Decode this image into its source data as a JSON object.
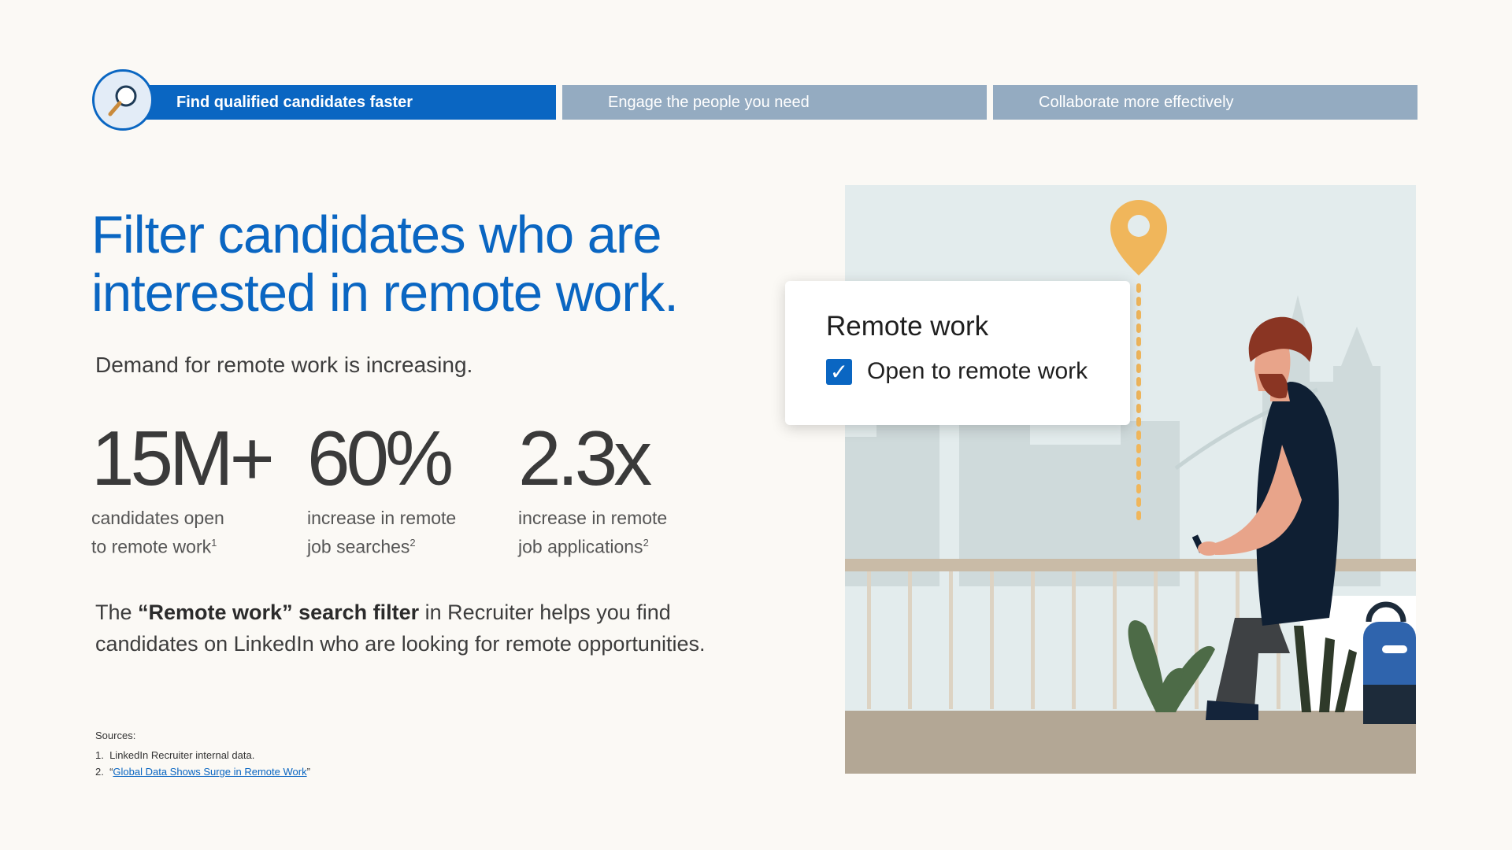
{
  "nav": {
    "icon": "magnifier-icon",
    "tabs": [
      {
        "label": "Find qualified candidates faster",
        "active": true
      },
      {
        "label": "Engage the people you need",
        "active": false
      },
      {
        "label": "Collaborate more effectively",
        "active": false
      }
    ]
  },
  "headline": {
    "line1": "Filter candidates who are",
    "line2": "interested in remote work."
  },
  "subhead": "Demand for remote work is increasing.",
  "stats": [
    {
      "value": "15M+",
      "desc_line1": "candidates open",
      "desc_line2": "to remote work",
      "footnote": "1"
    },
    {
      "value": "60%",
      "desc_line1": "increase in remote",
      "desc_line2": "job searches",
      "footnote": "2"
    },
    {
      "value": "2.3x",
      "desc_line1": "increase in remote",
      "desc_line2": "job applications",
      "footnote": "2"
    }
  ],
  "body": {
    "prefix": "The ",
    "bold": "“Remote work” search filter",
    "suffix": " in Recruiter helps you find candidates on LinkedIn who are looking for remote opportunities."
  },
  "sources": {
    "title": "Sources:",
    "items": [
      {
        "num": "1.",
        "text": "LinkedIn Recruiter internal data."
      },
      {
        "num": "2.",
        "pre": "“",
        "link": "Global Data Shows Surge in Remote Work",
        "post": "”"
      }
    ]
  },
  "card": {
    "title": "Remote work",
    "checkbox_label": "Open to remote work",
    "checked": true,
    "check_glyph": "✓"
  },
  "colors": {
    "brand_blue": "#0a66c2",
    "inactive_tab": "#94abc1",
    "background": "#fbf9f5",
    "pin": "#f0b65b"
  }
}
